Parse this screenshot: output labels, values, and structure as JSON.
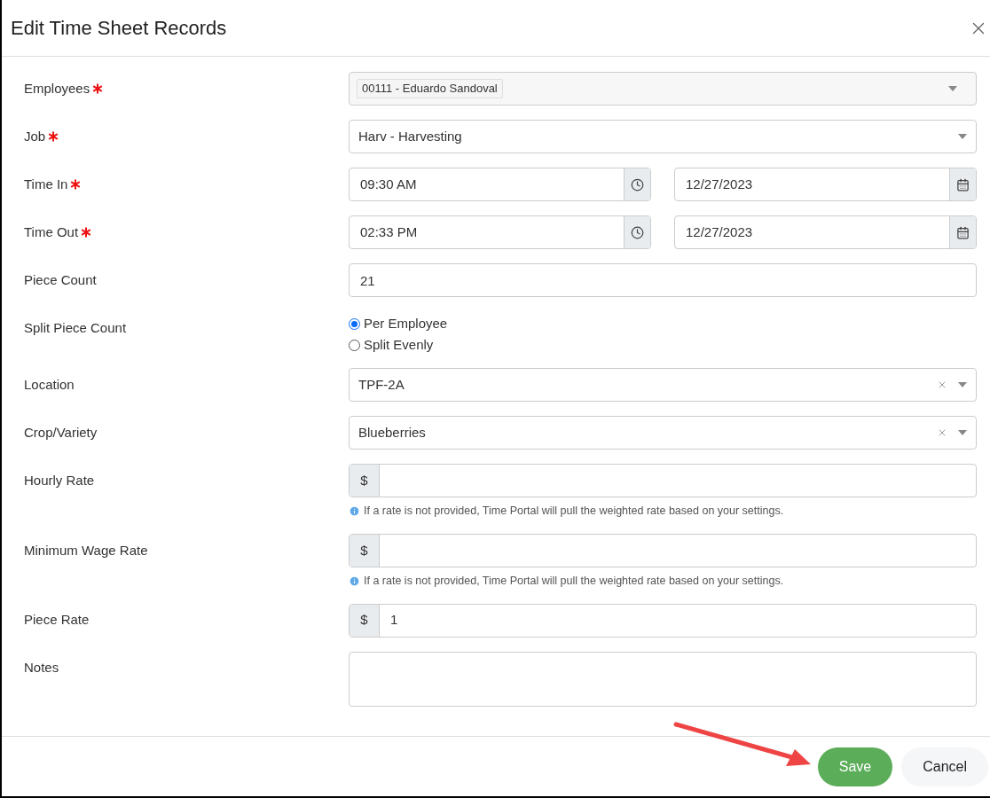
{
  "dialog": {
    "title": "Edit Time Sheet Records"
  },
  "fields": [
    {
      "kind": "tags",
      "label": "Employees",
      "required": true,
      "tags": [
        "00111 - Eduardo Sandoval"
      ]
    },
    {
      "kind": "select",
      "label": "Job",
      "required": true,
      "value": "Harv - Harvesting",
      "clearable": false
    },
    {
      "kind": "datetime",
      "label": "Time In",
      "required": true,
      "time": "09:30 AM",
      "date": "12/27/2023"
    },
    {
      "kind": "datetime",
      "label": "Time Out",
      "required": true,
      "time": "02:33 PM",
      "date": "12/27/2023"
    },
    {
      "kind": "text",
      "label": "Piece Count",
      "required": false,
      "value": "21"
    },
    {
      "kind": "radio",
      "label": "Split Piece Count",
      "required": false,
      "options": [
        {
          "label": "Per Employee",
          "selected": true
        },
        {
          "label": "Split Evenly",
          "selected": false
        }
      ]
    },
    {
      "kind": "select",
      "label": "Location",
      "required": false,
      "value": "TPF-2A",
      "clearable": true
    },
    {
      "kind": "select",
      "label": "Crop/Variety",
      "required": false,
      "value": "Blueberries",
      "clearable": true
    },
    {
      "kind": "currency",
      "label": "Hourly Rate",
      "required": false,
      "prefix": "$",
      "hint": "If a rate is not provided, Time Portal will pull the weighted rate based on your settings."
    },
    {
      "kind": "currency",
      "label": "Minimum Wage Rate",
      "required": false,
      "prefix": "$",
      "hint": "If a rate is not provided, Time Portal will pull the weighted rate based on your settings."
    },
    {
      "kind": "currency",
      "label": "Piece Rate",
      "required": false,
      "prefix": "$",
      "value": "1"
    },
    {
      "kind": "textarea",
      "label": "Notes",
      "required": false
    }
  ],
  "buttons": [
    {
      "label": "Save",
      "kind": "primary"
    },
    {
      "label": "Cancel",
      "kind": "secondary"
    }
  ]
}
